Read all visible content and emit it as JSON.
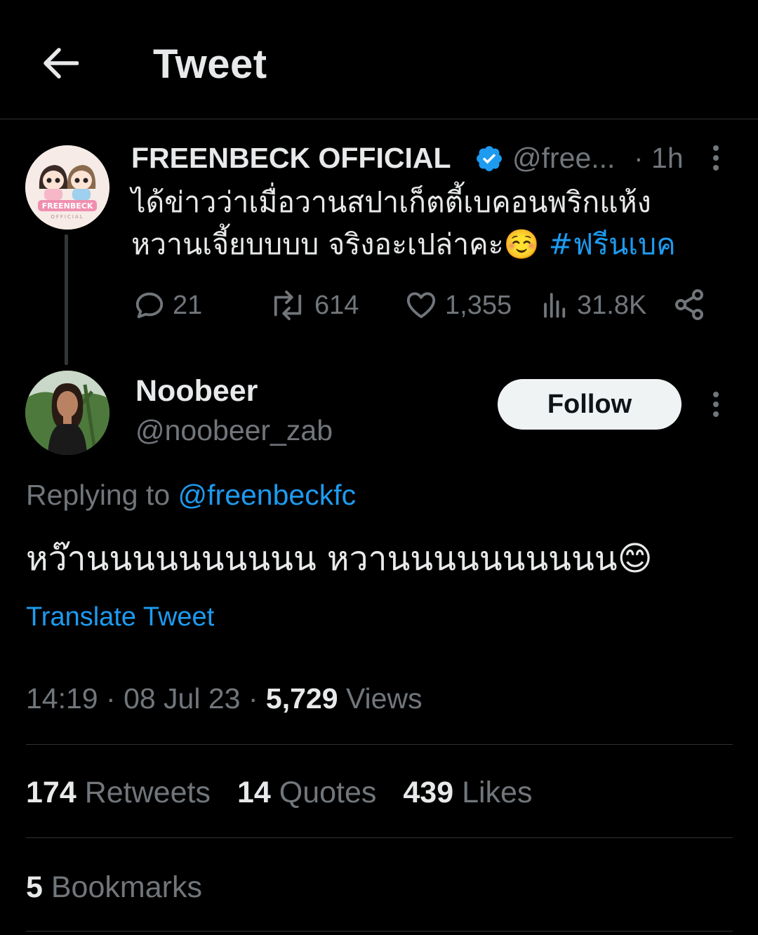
{
  "header": {
    "title": "Tweet"
  },
  "quoted_tweet": {
    "author_name": "FREENBECK OFFICIAL",
    "handle": "@free...",
    "time": "· 1h",
    "text": "ได้ข่าวว่าเมื่อวานสปาเก็ตตี้เบคอนพริกแห้ง หวานเจี้ยบบบบ จริงอะเปล่าคะ☺️",
    "hashtag": "#ฟรีนเบค",
    "avatar_text": "FREENBECK",
    "avatar_subtext": "OFFICIAL",
    "actions": {
      "replies": "21",
      "retweets": "614",
      "likes": "1,355",
      "views": "31.8K"
    }
  },
  "reply_tweet": {
    "author_name": "Noobeer",
    "handle": "@noobeer_zab",
    "follow_label": "Follow",
    "replying_prefix": "Replying to",
    "replying_handle": "@freenbeckfc",
    "text": "หว๊านนนนนนนนนน หวานนนนนนนนนน😊",
    "translate_label": "Translate Tweet",
    "time": "14:19",
    "date": "08 Jul 23",
    "views_count": "5,729",
    "views_label": "Views"
  },
  "stats": {
    "retweets_count": "174",
    "retweets_label": "Retweets",
    "quotes_count": "14",
    "quotes_label": "Quotes",
    "likes_count": "439",
    "likes_label": "Likes",
    "bookmarks_count": "5",
    "bookmarks_label": "Bookmarks"
  },
  "colors": {
    "background": "#000000",
    "accent": "#1d9bf0",
    "secondary_text": "#71767b",
    "primary_text": "#e7e9ea"
  }
}
